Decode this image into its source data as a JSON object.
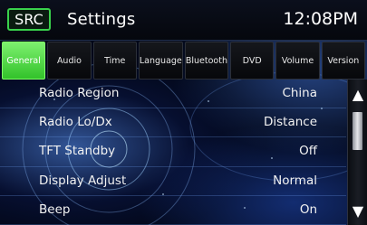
{
  "header": {
    "source_button_label": "SRC",
    "title": "Settings",
    "clock": "12:08PM"
  },
  "tabs": [
    {
      "label": "General",
      "active": true
    },
    {
      "label": "Audio",
      "active": false
    },
    {
      "label": "Time",
      "active": false
    },
    {
      "label": "Language",
      "active": false
    },
    {
      "label": "Bluetooth",
      "active": false
    },
    {
      "label": "DVD",
      "active": false
    },
    {
      "label": "Volume",
      "active": false
    },
    {
      "label": "Version",
      "active": false
    }
  ],
  "settings": [
    {
      "label": "Radio Region",
      "value": "China"
    },
    {
      "label": "Radio Lo/Dx",
      "value": "Distance"
    },
    {
      "label": "TFT Standby",
      "value": "Off"
    },
    {
      "label": "Display Adjust",
      "value": "Normal"
    },
    {
      "label": "Beep",
      "value": "On"
    }
  ],
  "scrollbar": {
    "up_icon": "triangle-up-icon",
    "down_icon": "triangle-down-icon"
  },
  "colors": {
    "active_tab": "#4cd43f",
    "src_border": "#39d14b",
    "background": "#020718"
  }
}
